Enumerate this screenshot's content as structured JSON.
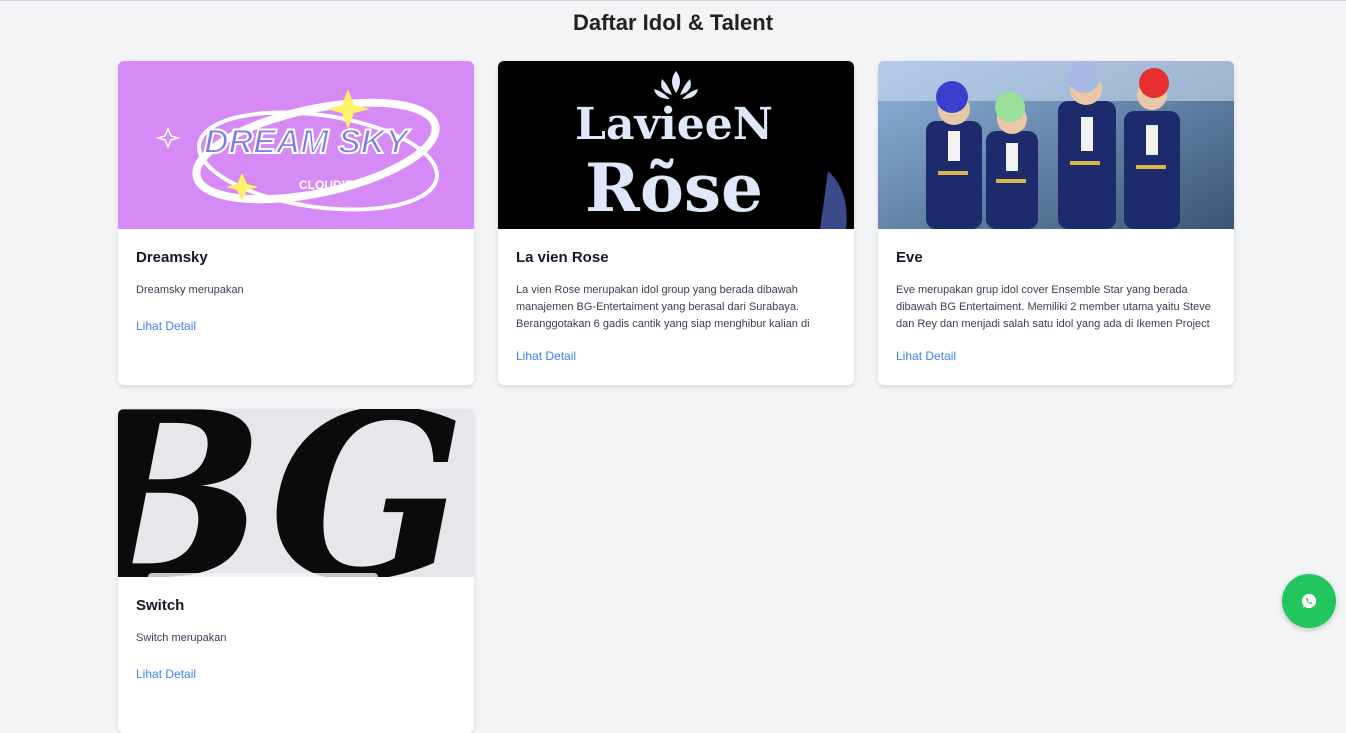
{
  "page": {
    "title": "Daftar Idol & Talent"
  },
  "cards": [
    {
      "image_text": "DREAM SKY",
      "image_subtext": "CLOUDIE",
      "title": "Dreamsky",
      "description": "Dreamsky merupakan",
      "link": "Lihat Detail"
    },
    {
      "image_text": "LavieeN",
      "image_subtext": "Rõse",
      "title": "La vien Rose",
      "description": "La vien Rose merupakan idol group yang berada dibawah manajemen BG-Entertaiment yang berasal dari Surabaya. Beranggotakan 6 gadis cantik yang siap menghibur kalian di event",
      "link": "Lihat Detail"
    },
    {
      "title": "Eve",
      "description": "Eve merupakan grup idol cover Ensemble Star yang berada dibawah BG Entertaiment. Memiliki 2 member utama yaitu Steve dan Rey dan menjadi salah satu idol yang ada di Ikemen Project",
      "link": "Lihat Detail"
    },
    {
      "image_text": "BG",
      "title": "Switch",
      "description": "Switch merupakan",
      "link": "Lihat Detail"
    }
  ],
  "fab": {
    "icon": "whatsapp-icon",
    "color": "#22c55e"
  }
}
